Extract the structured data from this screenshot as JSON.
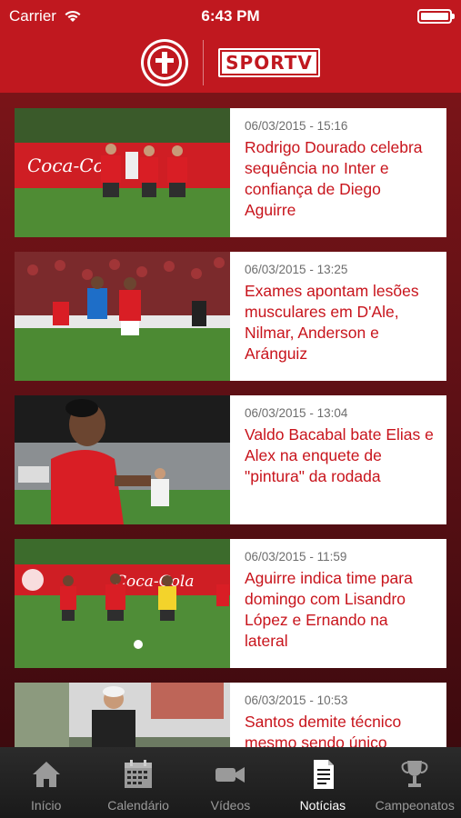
{
  "status_bar": {
    "carrier": "Carrier",
    "time": "6:43 PM"
  },
  "header": {
    "brand": "SPORTV"
  },
  "news": [
    {
      "date": "06/03/2015 - 15:16",
      "title": "Rodrigo Dourado celebra sequência no Inter e confiança de Diego Aguirre"
    },
    {
      "date": "06/03/2015 - 13:25",
      "title": "Exames apontam lesões musculares em D'Ale, Nilmar, Anderson e Aránguiz"
    },
    {
      "date": "06/03/2015 - 13:04",
      "title": "Valdo Bacabal bate Elias e Alex na enquete de \"pintura\" da rodada"
    },
    {
      "date": "06/03/2015 - 11:59",
      "title": "Aguirre indica time para domingo com Lisandro López e Ernando na lateral"
    },
    {
      "date": "06/03/2015 - 10:53",
      "title": "Santos demite técnico mesmo sendo único"
    }
  ],
  "tabs": [
    {
      "label": "Início",
      "icon": "home-icon",
      "active": false
    },
    {
      "label": "Calendário",
      "icon": "calendar-icon",
      "active": false
    },
    {
      "label": "Vídeos",
      "icon": "video-camera-icon",
      "active": false
    },
    {
      "label": "Notícias",
      "icon": "news-document-icon",
      "active": true
    },
    {
      "label": "Campeonatos",
      "icon": "trophy-icon",
      "active": false
    }
  ],
  "colors": {
    "brand_red": "#c0181f",
    "title_red": "#c8141c",
    "tab_active": "#ffffff",
    "tab_inactive": "#9a9a9a"
  }
}
